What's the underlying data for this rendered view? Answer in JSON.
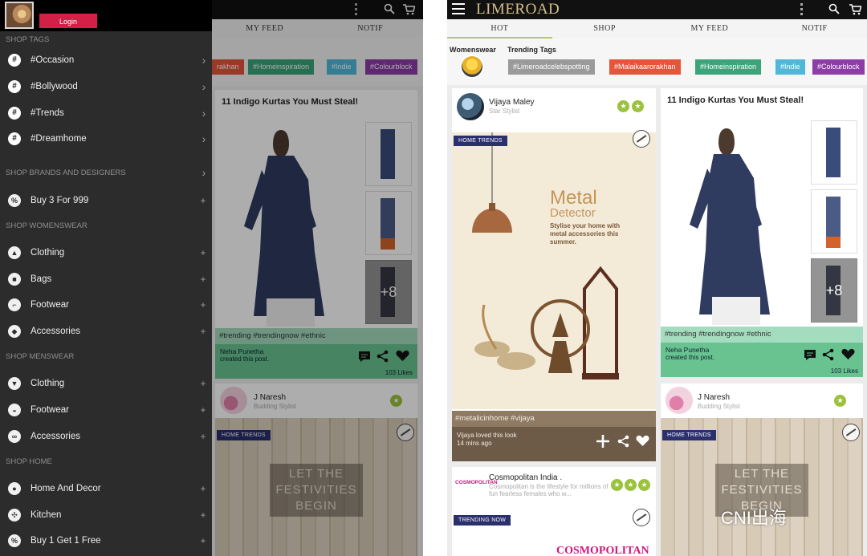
{
  "left": {
    "under": {
      "tabs": [
        "MY FEED",
        "NOTIF"
      ],
      "chips": [
        {
          "label": "rakhan",
          "color": "#e4553a"
        },
        {
          "label": "#Homeinspiration",
          "color": "#3ca37b"
        },
        {
          "label": "#Indie",
          "color": "#4fb8d9"
        },
        {
          "label": "#Colourblock",
          "color": "#8d3da8"
        }
      ],
      "card": {
        "title": "11 Indigo Kurtas You Must Steal!",
        "plus_count": "+8",
        "hashtags": "#trending  #trendingnow  #ethnic",
        "author": "Neha Punetha",
        "author_note": "created this post.",
        "likes": "103 Likes"
      },
      "card2": {
        "name": "J Naresh",
        "role": "Budding Stylist",
        "badge": "HOME TRENDS",
        "overlay": "LET THE FESTIVITIES BEGIN"
      }
    },
    "drawer": {
      "login": "Login",
      "sections": [
        {
          "title": "SHOP TAGS"
        },
        {
          "title": "SHOP BRANDS AND DESIGNERS"
        },
        {
          "title": "SHOP WOMENSWEAR"
        },
        {
          "title": "SHOP MENSWEAR"
        },
        {
          "title": "SHOP HOME"
        }
      ],
      "tags": [
        "#Occasion",
        "#Bollywood",
        "#Trends",
        "#Dreamhome"
      ],
      "brands_item": "Buy 3 For 999",
      "womenswear": [
        "Clothing",
        "Bags",
        "Footwear",
        "Accessories"
      ],
      "menswear": [
        "Clothing",
        "Footwear",
        "Accessories"
      ],
      "home": [
        "Home And Decor",
        "Kitchen",
        "Buy 1 Get 1 Free"
      ]
    }
  },
  "right": {
    "logo": "LIMEROAD",
    "tabs": [
      "HOT",
      "SHOP",
      "MY FEED",
      "NOTIF"
    ],
    "tagstrip": {
      "womenswear_label": "Womenswear",
      "trending_label": "Trending Tags",
      "chips": [
        {
          "label": "#Limeroadcelebspotting",
          "color": "#9a9a9a"
        },
        {
          "label": "#Malaikaarorakhan",
          "color": "#e4553a"
        },
        {
          "label": "#Homeinspiration",
          "color": "#3ca37b"
        },
        {
          "label": "#Indie",
          "color": "#4fb8d9"
        },
        {
          "label": "#Colourblock",
          "color": "#8d3da8"
        }
      ]
    },
    "card_vijaya": {
      "name": "Vijaya Maley",
      "role": "Star Stylist",
      "badge": "HOME TRENDS",
      "ad_title_1": "Metal",
      "ad_title_2": "Detector",
      "ad_text": "Stylise your home with metal accessories this summer.",
      "hashtags": "#metalicinhome  #vijaya",
      "footer_line1": "Vijaya loved this look",
      "footer_line2": "14 mins ago"
    },
    "card_kurtas": {
      "title": "11 Indigo Kurtas You Must Steal!",
      "plus_count": "+8",
      "hashtags": "#trending  #trendingnow  #ethnic",
      "author": "Neha Punetha",
      "author_note": "created this post.",
      "likes": "103 Likes"
    },
    "card_cosmo": {
      "name": "Cosmopolitan India .",
      "desc": "Cosmopolitan is the lifestyle for millions of fun fearless females who w...",
      "logo_small": "COSMOPOLITAN",
      "badge": "TRENDING NOW",
      "masthead": "COSMOPOLITAN"
    },
    "card_naresh": {
      "name": "J Naresh",
      "role": "Budding Stylist",
      "badge": "HOME TRENDS",
      "overlay": "LET THE FESTIVITIES BEGIN"
    }
  },
  "watermark": "CNI出海"
}
